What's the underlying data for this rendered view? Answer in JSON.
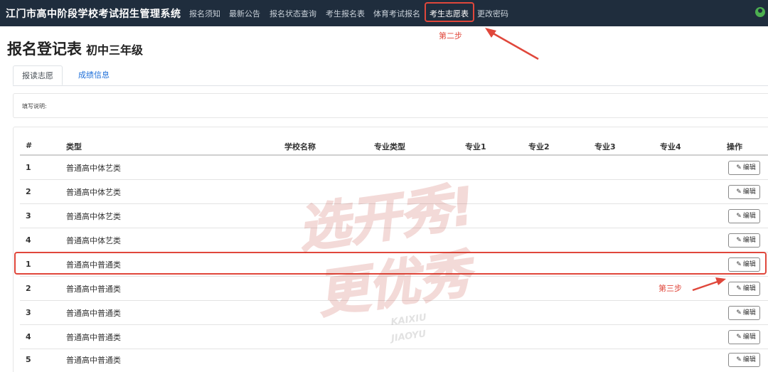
{
  "header": {
    "brand": "江门市高中阶段学校考试招生管理系统",
    "nav": [
      {
        "label": "报名须知"
      },
      {
        "label": "最新公告"
      },
      {
        "label": "报名状态查询"
      },
      {
        "label": "考生报名表"
      },
      {
        "label": "体育考试报名"
      },
      {
        "label": "考生志愿表"
      },
      {
        "label": "更改密码"
      }
    ],
    "active_nav": "考生志愿表",
    "user_icon": "user-circle-icon"
  },
  "annotations": {
    "step2": "第二步",
    "step3": "第三步",
    "color": "#e0473b"
  },
  "page": {
    "title": "报名登记表",
    "subtitle": "初中三年级"
  },
  "tabs": [
    {
      "label": "报读志愿",
      "active": true
    },
    {
      "label": "成绩信息",
      "active": false
    }
  ],
  "notes": {
    "label": "填写说明:"
  },
  "table": {
    "columns": [
      "#",
      "类型",
      "学校名称",
      "专业类型",
      "专业1",
      "专业2",
      "专业3",
      "专业4",
      "操作"
    ],
    "edit_label": "编辑",
    "rows": [
      {
        "num": "1",
        "type": "普通高中体艺类"
      },
      {
        "num": "2",
        "type": "普通高中体艺类"
      },
      {
        "num": "3",
        "type": "普通高中体艺类"
      },
      {
        "num": "4",
        "type": "普通高中体艺类"
      },
      {
        "num": "1",
        "type": "普通高中普通类"
      },
      {
        "num": "2",
        "type": "普通高中普通类"
      },
      {
        "num": "3",
        "type": "普通高中普通类"
      },
      {
        "num": "4",
        "type": "普通高中普通类"
      },
      {
        "num": "5",
        "type": "普通高中普通类"
      }
    ]
  },
  "watermark": {
    "line1": "选开秀!",
    "line2": "更优秀",
    "line3": "KAIXIU",
    "line4": "JIAOYU"
  },
  "colors": {
    "navbar": "#1f2d3d",
    "link": "#1e6fd9",
    "highlight": "#e0473b"
  }
}
